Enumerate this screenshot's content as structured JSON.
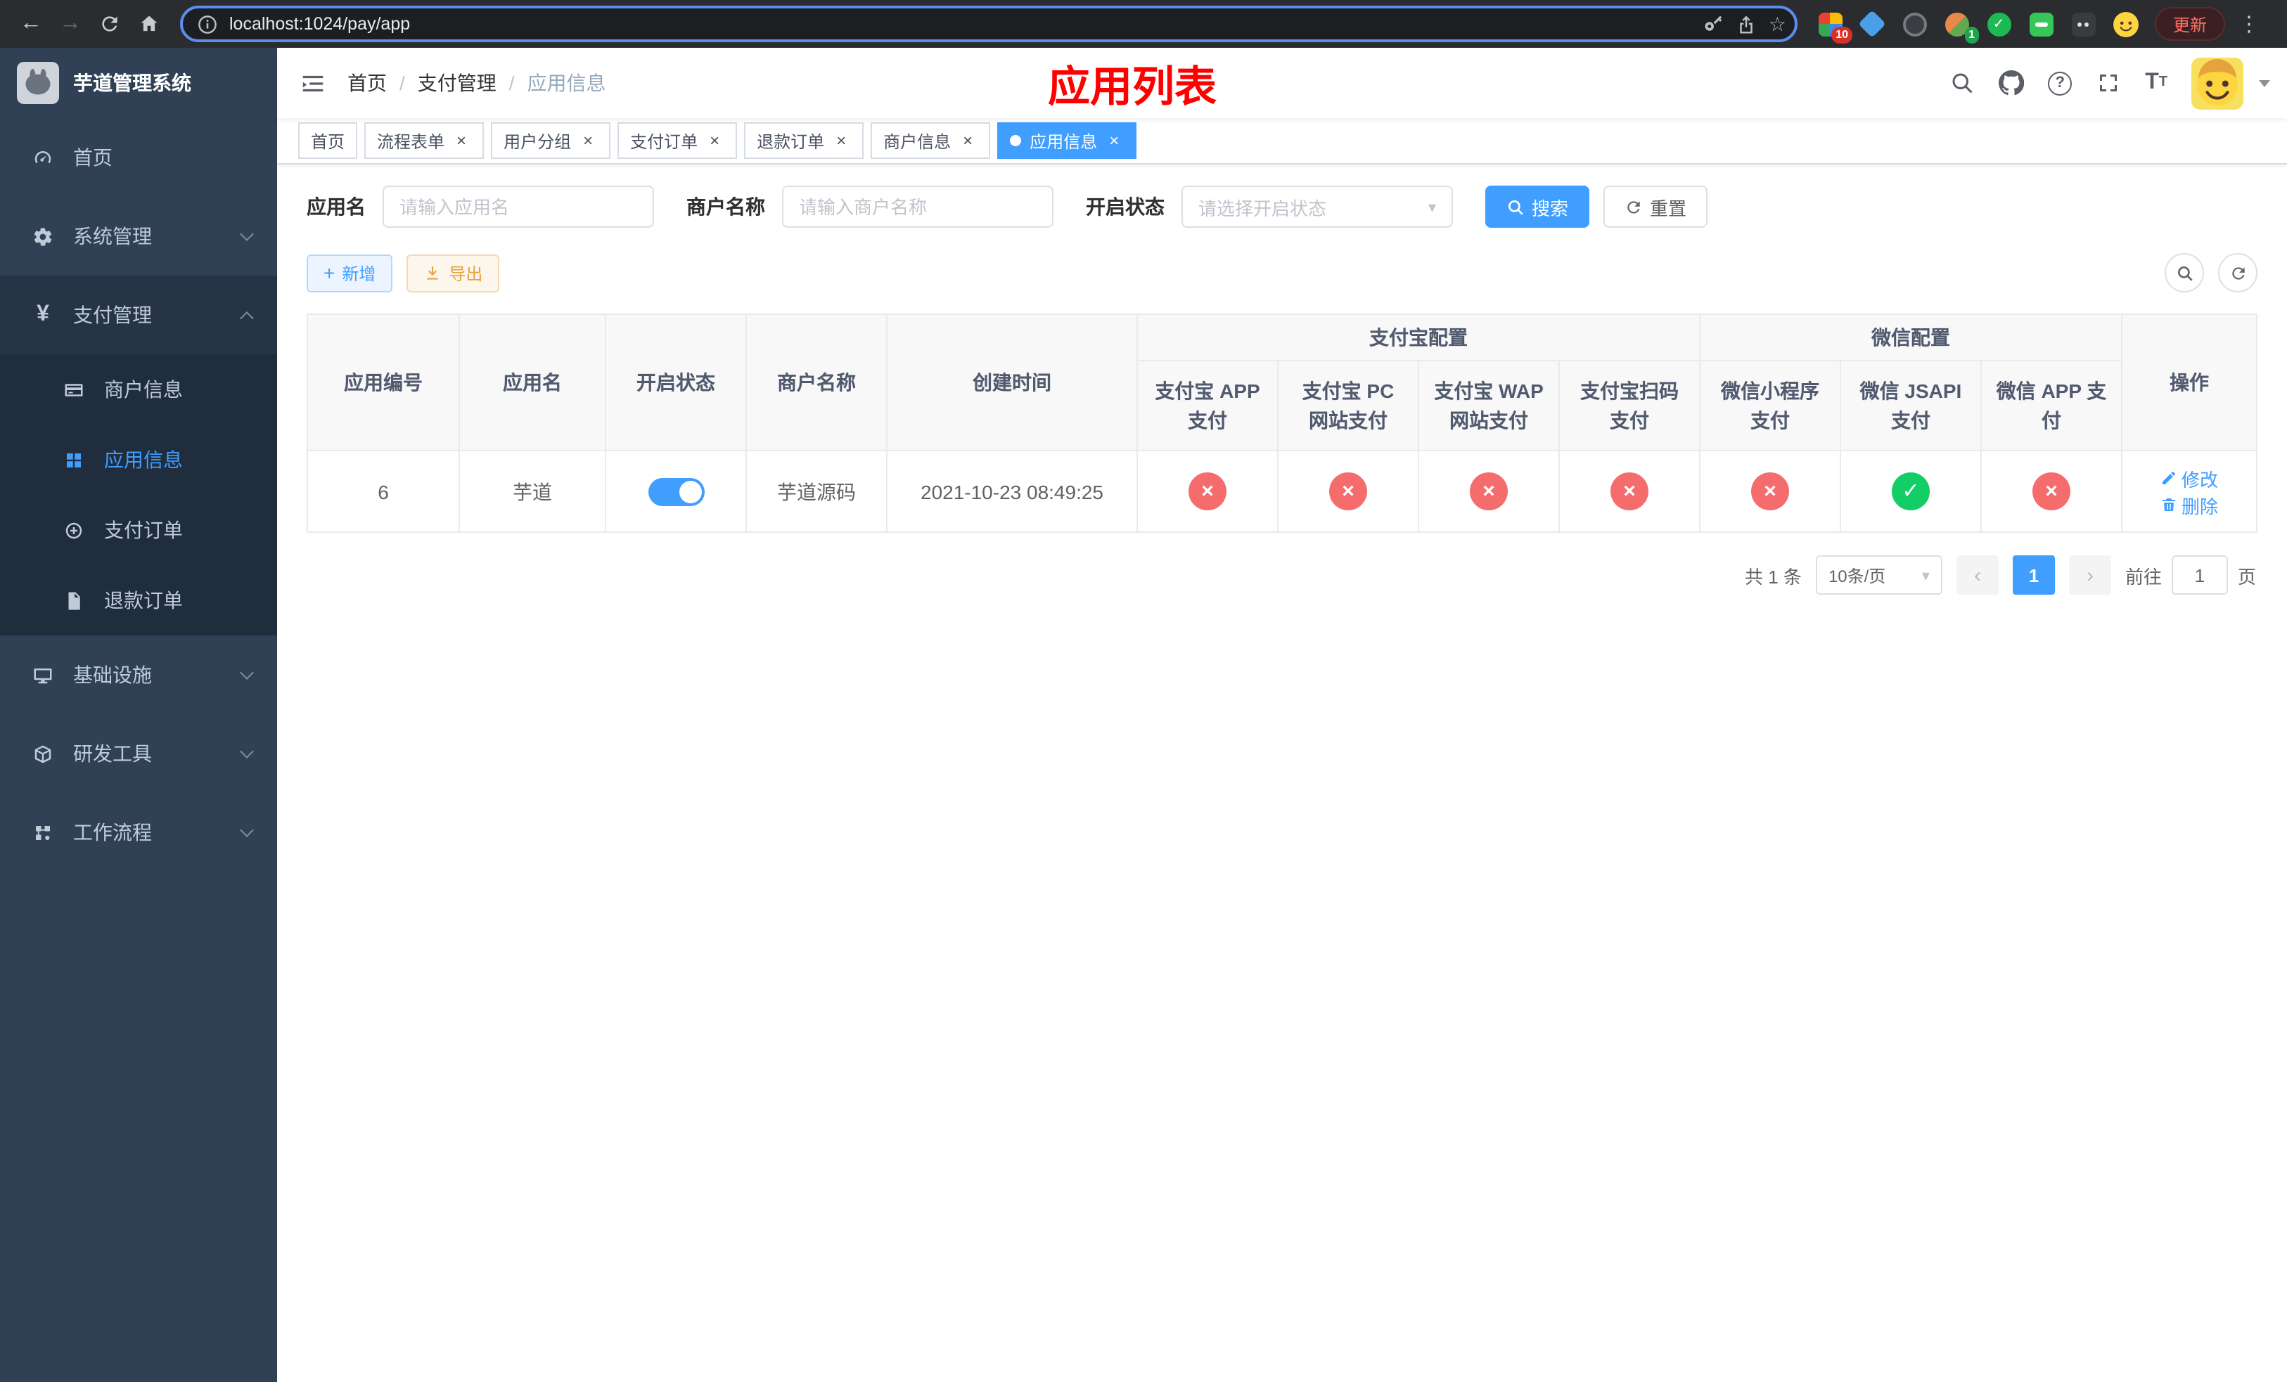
{
  "browser": {
    "url": "localhost:1024/pay/app",
    "update_button": "更新",
    "extension_badge_count": "10",
    "profile_badge_count": "1"
  },
  "app_title": "芋道管理系统",
  "sidebar": {
    "items": [
      {
        "label": "首页"
      },
      {
        "label": "系统管理"
      },
      {
        "label": "支付管理"
      },
      {
        "label": "基础设施"
      },
      {
        "label": "研发工具"
      },
      {
        "label": "工作流程"
      }
    ],
    "pay_children": [
      {
        "label": "商户信息"
      },
      {
        "label": "应用信息"
      },
      {
        "label": "支付订单"
      },
      {
        "label": "退款订单"
      }
    ]
  },
  "header": {
    "breadcrumb": [
      "首页",
      "支付管理",
      "应用信息"
    ],
    "separator": "/",
    "page_title": "应用列表"
  },
  "tabs": [
    {
      "label": "首页"
    },
    {
      "label": "流程表单"
    },
    {
      "label": "用户分组"
    },
    {
      "label": "支付订单"
    },
    {
      "label": "退款订单"
    },
    {
      "label": "商户信息"
    },
    {
      "label": "应用信息"
    }
  ],
  "search": {
    "app_name_label": "应用名",
    "app_name_placeholder": "请输入应用名",
    "merchant_label": "商户名称",
    "merchant_placeholder": "请输入商户名称",
    "status_label": "开启状态",
    "status_placeholder": "请选择开启状态",
    "search_button": "搜索",
    "reset_button": "重置"
  },
  "toolbar": {
    "add_button": "新增",
    "export_button": "导出"
  },
  "table": {
    "headers": {
      "app_id": "应用编号",
      "app_name": "应用名",
      "status": "开启状态",
      "merchant": "商户名称",
      "create_time": "创建时间",
      "alipay_group": "支付宝配置",
      "wechat_group": "微信配置",
      "actions": "操作",
      "alipay_app": "支付宝 APP 支付",
      "alipay_pc": "支付宝 PC 网站支付",
      "alipay_wap": "支付宝 WAP 网站支付",
      "alipay_scan": "支付宝扫码支付",
      "wechat_mini": "微信小程序支付",
      "wechat_jsapi": "微信 JSAPI 支付",
      "wechat_app": "微信 APP 支付"
    },
    "rows": [
      {
        "app_id": "6",
        "app_name": "芋道",
        "status_on": true,
        "merchant": "芋道源码",
        "create_time": "2021-10-23 08:49:25",
        "configs": [
          "no",
          "no",
          "no",
          "no",
          "no",
          "yes",
          "no"
        ],
        "edit_label": "修改",
        "delete_label": "删除"
      }
    ]
  },
  "pagination": {
    "total": "共 1 条",
    "page_size": "10条/页",
    "current_page": "1",
    "goto_prefix": "前往",
    "goto_suffix": "页",
    "goto_value": "1"
  },
  "icons": {
    "back": "←",
    "forward": "→",
    "more": "⋮",
    "star": "☆",
    "close": "×",
    "check": "✓",
    "cross": "×",
    "plus": "+",
    "caret": "▾",
    "prev": "‹",
    "next": "›",
    "yen": "¥",
    "question": "?",
    "font_big": "T",
    "font_small": "T"
  },
  "colors": {
    "primary": "#409eff",
    "danger": "#f56c6c",
    "success": "#13ce66",
    "title_red": "#ff0000",
    "sidebar_bg": "#304156",
    "submenu_bg": "#1f2d3d"
  }
}
